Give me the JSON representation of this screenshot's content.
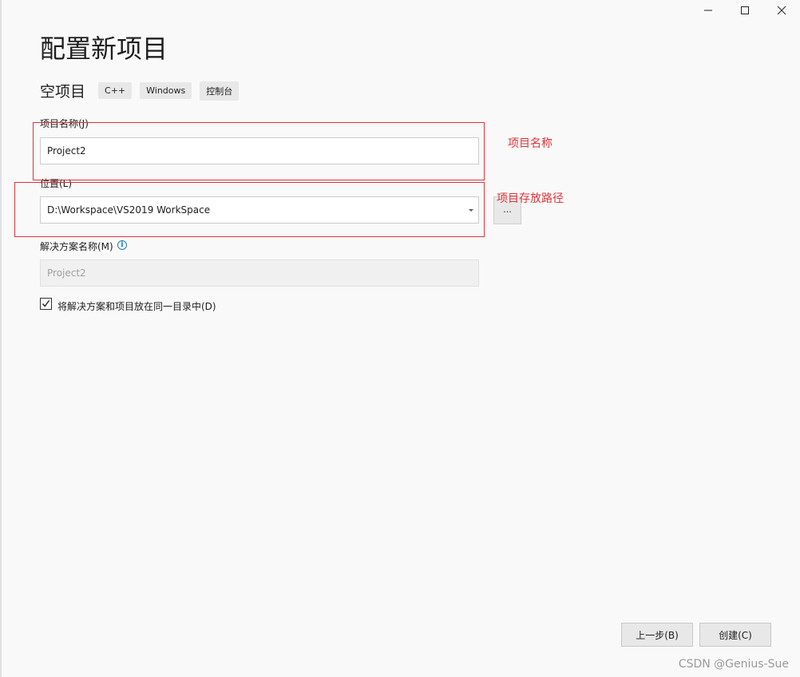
{
  "window": {
    "controls": [
      {
        "name": "minimize-icon",
        "symbol": "minimize"
      },
      {
        "name": "maximize-icon",
        "symbol": "maximize"
      },
      {
        "name": "close-icon",
        "symbol": "close"
      }
    ]
  },
  "header": {
    "title": "配置新项目",
    "template_name": "空项目",
    "tags": [
      "C++",
      "Windows",
      "控制台"
    ]
  },
  "form": {
    "project_name": {
      "label": "项目名称(J)",
      "value": "Project2"
    },
    "location": {
      "label": "位置(L)",
      "value": "D:\\Workspace\\VS2019 WorkSpace",
      "browse_label": "..."
    },
    "solution_name": {
      "label": "解决方案名称(M)",
      "value": "Project2",
      "info_icon": "i"
    },
    "same_dir_checkbox": {
      "label": "将解决方案和项目放在同一目录中(D)",
      "checked": true
    }
  },
  "annotations": {
    "project_name_note": "项目名称",
    "location_note": "项目存放路径",
    "color": "#e0333a"
  },
  "footer": {
    "back_label": "上一步(B)",
    "create_label": "创建(C)"
  },
  "watermark": "CSDN @Genius-Sue"
}
